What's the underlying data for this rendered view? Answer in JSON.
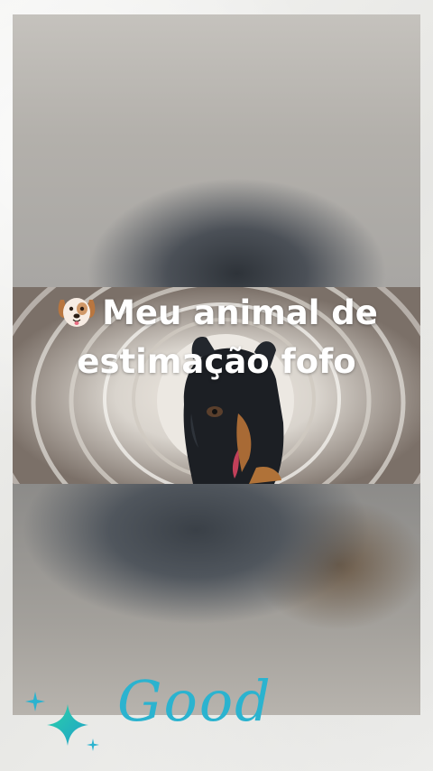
{
  "title": {
    "line1": "Meu animal de",
    "line2": "estimação fofo",
    "emoji": "dog-face-icon"
  },
  "signature": "Good",
  "colors": {
    "accent": "#2bb3cf",
    "text": "#ffffff",
    "background": "#eeeeec"
  }
}
